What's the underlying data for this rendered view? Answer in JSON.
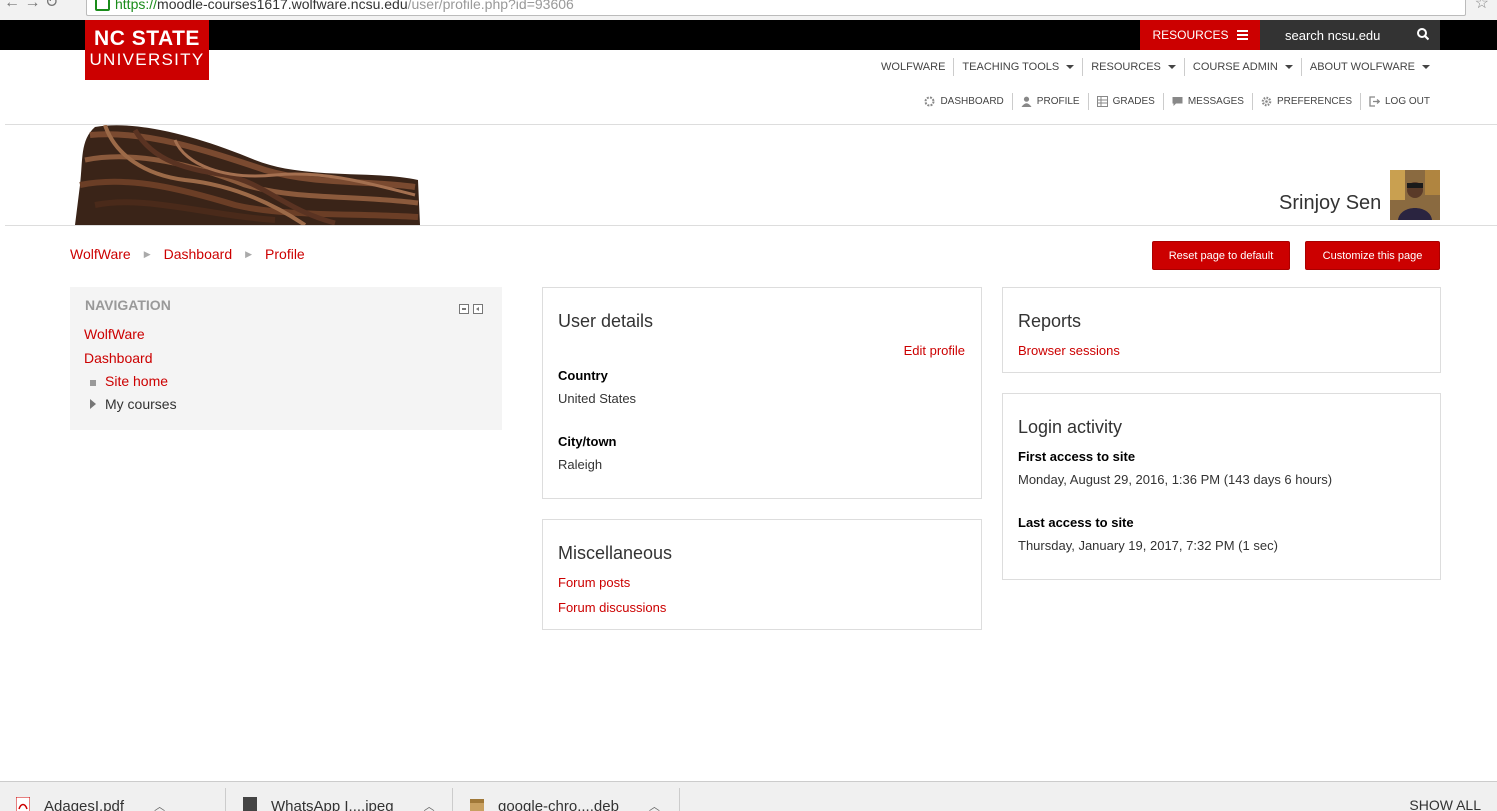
{
  "browser": {
    "url_scheme": "https://",
    "url_host": "moodle-courses1617.wolfware.ncsu.edu",
    "url_path": "/user/profile.php?id=93606"
  },
  "topbar": {
    "resources_label": "RESOURCES",
    "search_placeholder": "search ncsu.edu"
  },
  "logo": {
    "line1": "NC STATE",
    "line2": "UNIVERSITY"
  },
  "main_nav": [
    {
      "label": "WOLFWARE"
    },
    {
      "label": "TEACHING TOOLS"
    },
    {
      "label": "RESOURCES"
    },
    {
      "label": "COURSE ADMIN"
    },
    {
      "label": "ABOUT WOLFWARE"
    }
  ],
  "user_nav": [
    {
      "label": "DASHBOARD",
      "icon": "dashboard-icon"
    },
    {
      "label": "PROFILE",
      "icon": "person-icon"
    },
    {
      "label": "GRADES",
      "icon": "grades-icon"
    },
    {
      "label": "MESSAGES",
      "icon": "message-icon"
    },
    {
      "label": "PREFERENCES",
      "icon": "gear-icon"
    },
    {
      "label": "LOG OUT",
      "icon": "logout-icon"
    }
  ],
  "user": {
    "name": "Srinjoy Sen"
  },
  "breadcrumb": [
    "WolfWare",
    "Dashboard",
    "Profile"
  ],
  "buttons": {
    "reset": "Reset page to default",
    "customize": "Customize this page"
  },
  "navigation_block": {
    "title": "NAVIGATION",
    "items": [
      "WolfWare",
      "Dashboard",
      "Site home",
      "My courses"
    ]
  },
  "user_details": {
    "title": "User details",
    "edit_profile": "Edit profile",
    "country_label": "Country",
    "country_value": "United States",
    "city_label": "City/town",
    "city_value": "Raleigh"
  },
  "miscellaneous": {
    "title": "Miscellaneous",
    "links": [
      "Forum posts",
      "Forum discussions"
    ]
  },
  "reports": {
    "title": "Reports",
    "links": [
      "Browser sessions"
    ]
  },
  "login_activity": {
    "title": "Login activity",
    "first_label": "First access to site",
    "first_value": "Monday, August 29, 2016, 1:36 PM  (143 days 6 hours)",
    "last_label": "Last access to site",
    "last_value": "Thursday, January 19, 2017, 7:32 PM  (1 sec)"
  },
  "downloads": {
    "items": [
      "AdagesI.pdf",
      "WhatsApp I....jpeg",
      "google-chro....deb"
    ],
    "show_all": "SHOW ALL"
  },
  "colors": {
    "accent": "#cc0000",
    "black_bar": "#000000",
    "search_bg": "#333333"
  }
}
